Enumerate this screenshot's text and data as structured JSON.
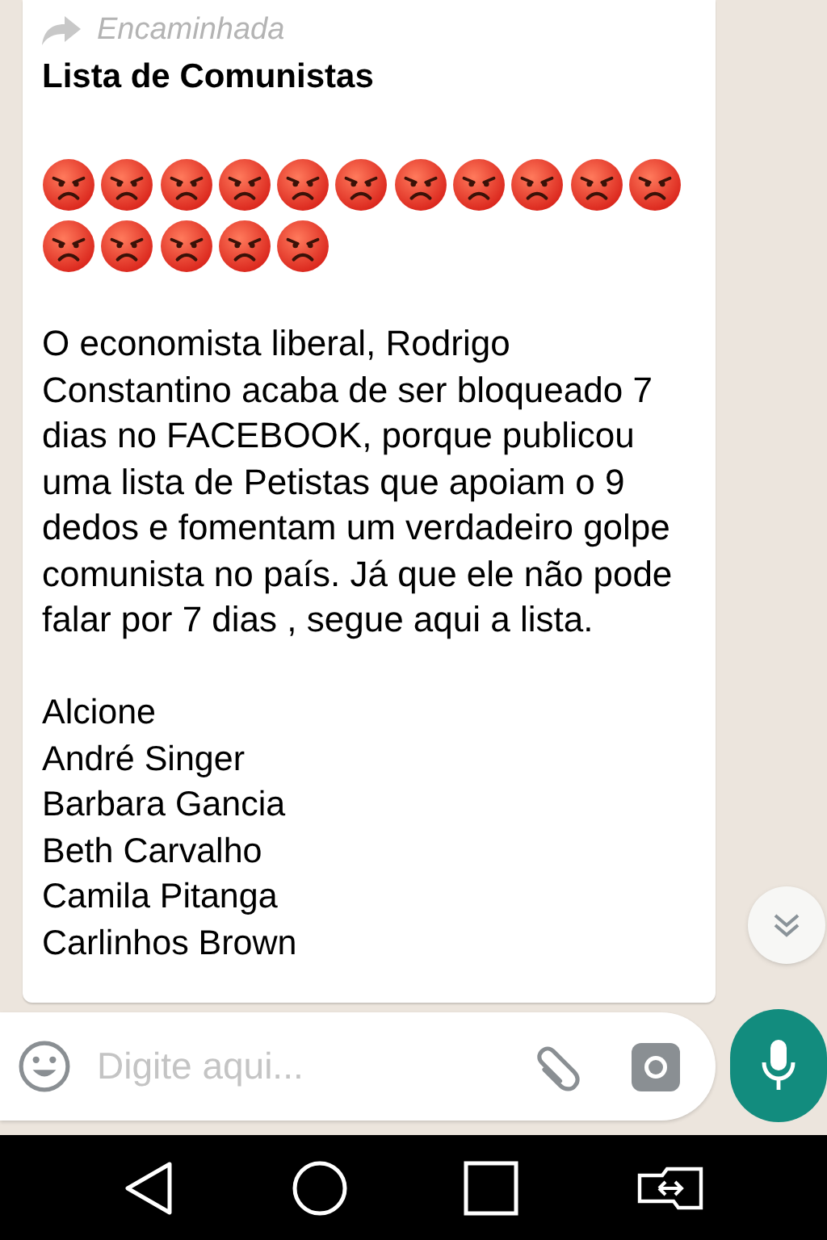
{
  "message": {
    "forwarded_label": "Encaminhada",
    "title": "Lista de Comunistas",
    "emojis": [
      {
        "kind": "angry"
      },
      {
        "kind": "angry"
      },
      {
        "kind": "angry"
      },
      {
        "kind": "angry"
      },
      {
        "kind": "angry"
      },
      {
        "kind": "angry"
      },
      {
        "kind": "angry"
      },
      {
        "kind": "angry"
      },
      {
        "kind": "angry"
      },
      {
        "kind": "angry"
      },
      {
        "kind": "angry"
      },
      {
        "kind": "angry"
      },
      {
        "kind": "angry"
      },
      {
        "kind": "angry"
      },
      {
        "kind": "angry"
      },
      {
        "kind": "angry"
      }
    ],
    "body": "O economista liberal, Rodrigo Constantino acaba de ser bloqueado 7 dias no FACEBOOK, porque publicou uma lista de Petistas que apoiam o 9 dedos e fomentam um verdadeiro golpe comunista no país. Já que ele não pode falar por 7 dias , segue aqui a lista.",
    "names": [
      "Alcione",
      "André Singer",
      "Barbara Gancia",
      "Beth Carvalho",
      "Camila Pitanga",
      "Carlinhos Brown"
    ]
  },
  "composer": {
    "placeholder": "Digite aqui..."
  }
}
